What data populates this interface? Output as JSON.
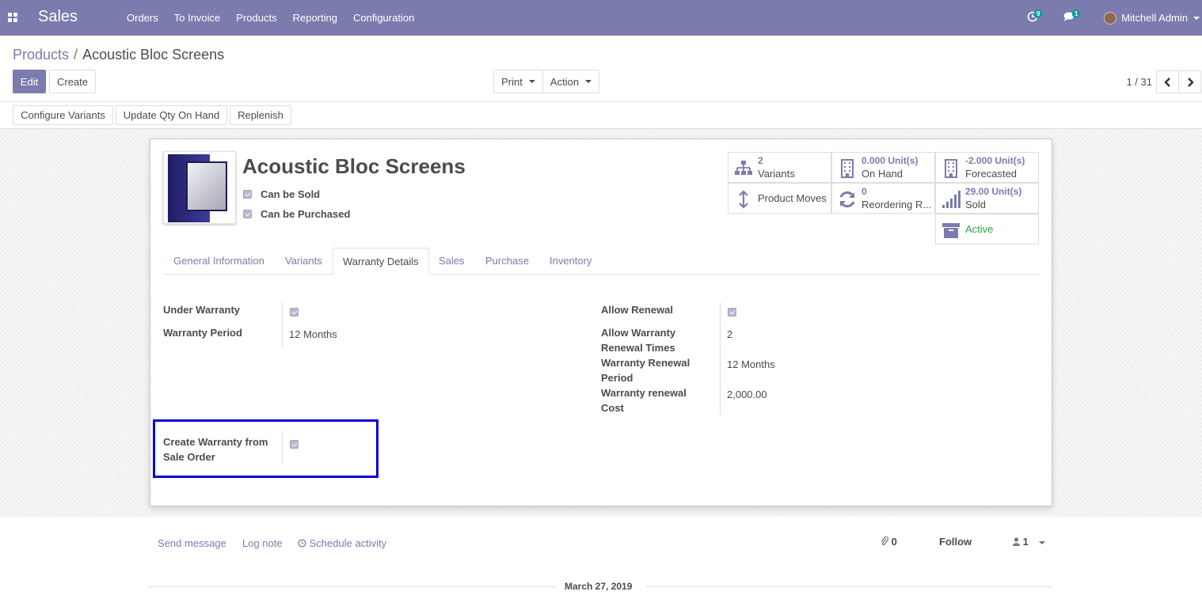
{
  "navbar": {
    "app_name": "Sales",
    "menu": [
      "Orders",
      "To Invoice",
      "Products",
      "Reporting",
      "Configuration"
    ],
    "activity_count": "9",
    "message_count": "1",
    "user_name": "Mitchell Admin",
    "color": "#7c7bad"
  },
  "breadcrumb": {
    "parent": "Products",
    "current": "Acoustic Bloc Screens"
  },
  "buttons": {
    "edit": "Edit",
    "create": "Create",
    "print": "Print",
    "action": "Action"
  },
  "pager": {
    "value": "1 / 31"
  },
  "statusbar": {
    "configure_variants": "Configure Variants",
    "update_qty": "Update Qty On Hand",
    "replenish": "Replenish"
  },
  "product": {
    "name": "Acoustic Bloc Screens",
    "can_be_sold_label": "Can be Sold",
    "can_be_sold": true,
    "can_be_purchased_label": "Can be Purchased",
    "can_be_purchased": true
  },
  "smart_buttons": {
    "variants": {
      "value": "2",
      "label": "Variants"
    },
    "on_hand": {
      "value": "0.000",
      "unit": "Unit(s)",
      "label": "On Hand"
    },
    "forecasted": {
      "value": "-2.000",
      "unit": "Unit(s)",
      "label": "Forecasted"
    },
    "product_moves": {
      "label": "Product Moves"
    },
    "reordering": {
      "value": "0",
      "label": "Reordering R..."
    },
    "sold": {
      "value": "29.00",
      "unit": "Unit(s)",
      "label": "Sold"
    },
    "active": {
      "label": "Active",
      "color": "#28a745"
    }
  },
  "tabs": [
    "General Information",
    "Variants",
    "Warranty Details",
    "Sales",
    "Purchase",
    "Inventory"
  ],
  "active_tab": "Warranty Details",
  "warranty": {
    "under_warranty_label": "Under Warranty",
    "under_warranty": true,
    "period_label": "Warranty Period",
    "period_value": "12 Months",
    "allow_renewal_label": "Allow Renewal",
    "allow_renewal": true,
    "renewal_times_label_1": "Allow Warranty",
    "renewal_times_label_2": "Renewal Times",
    "renewal_times_value": "2",
    "renewal_period_label_1": "Warranty Renewal",
    "renewal_period_label_2": "Period",
    "renewal_period_value": "12 Months",
    "renewal_cost_label_1": "Warranty renewal",
    "renewal_cost_label_2": "Cost",
    "renewal_cost_value": "2,000.00",
    "create_from_so_label_1": "Create Warranty from",
    "create_from_so_label_2": "Sale Order",
    "create_from_so": true,
    "highlight_color": "#0000d6"
  },
  "chatter": {
    "send_message": "Send message",
    "log_note": "Log note",
    "schedule_activity": "Schedule activity",
    "attachments": "0",
    "follow": "Follow",
    "followers": "1",
    "date": "March 27, 2019"
  }
}
